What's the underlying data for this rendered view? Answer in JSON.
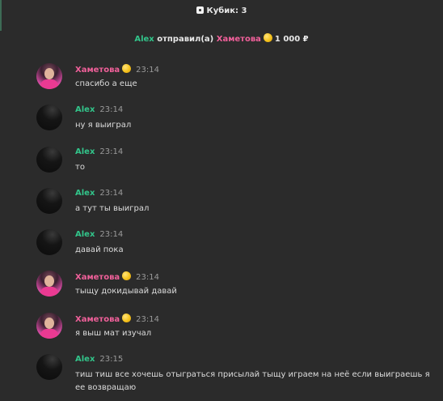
{
  "system": {
    "dice_label": "Кубик: 3",
    "transfer": {
      "sender": "Alex",
      "verb": "отправил(а)",
      "recipient": "Хаметова",
      "amount": "1 000 ₽"
    }
  },
  "messages": [
    {
      "author": "Хаметова",
      "author_color": "#f0609a",
      "has_emoji": true,
      "time": "23:14",
      "text": "спасибо а еще",
      "avatar": "photo"
    },
    {
      "author": "Alex",
      "author_color": "#32c48a",
      "has_emoji": false,
      "time": "23:14",
      "text": "ну я выиграл",
      "avatar": "dark"
    },
    {
      "author": "Alex",
      "author_color": "#32c48a",
      "has_emoji": false,
      "time": "23:14",
      "text": "то",
      "avatar": "dark"
    },
    {
      "author": "Alex",
      "author_color": "#32c48a",
      "has_emoji": false,
      "time": "23:14",
      "text": "а тут ты выиграл",
      "avatar": "dark"
    },
    {
      "author": "Alex",
      "author_color": "#32c48a",
      "has_emoji": false,
      "time": "23:14",
      "text": "давай пока",
      "avatar": "dark"
    },
    {
      "author": "Хаметова",
      "author_color": "#f0609a",
      "has_emoji": true,
      "time": "23:14",
      "text": "тыщу докидывай давай",
      "avatar": "photo"
    },
    {
      "author": "Хаметова",
      "author_color": "#f0609a",
      "has_emoji": true,
      "time": "23:14",
      "text": "я выш мат изучал",
      "avatar": "photo"
    },
    {
      "author": "Alex",
      "author_color": "#32c48a",
      "has_emoji": false,
      "time": "23:15",
      "text": "тиш тиш все хочешь отыграться присылай тыщу играем на неё если выиграешь я ее возвращаю",
      "avatar": "dark"
    }
  ]
}
